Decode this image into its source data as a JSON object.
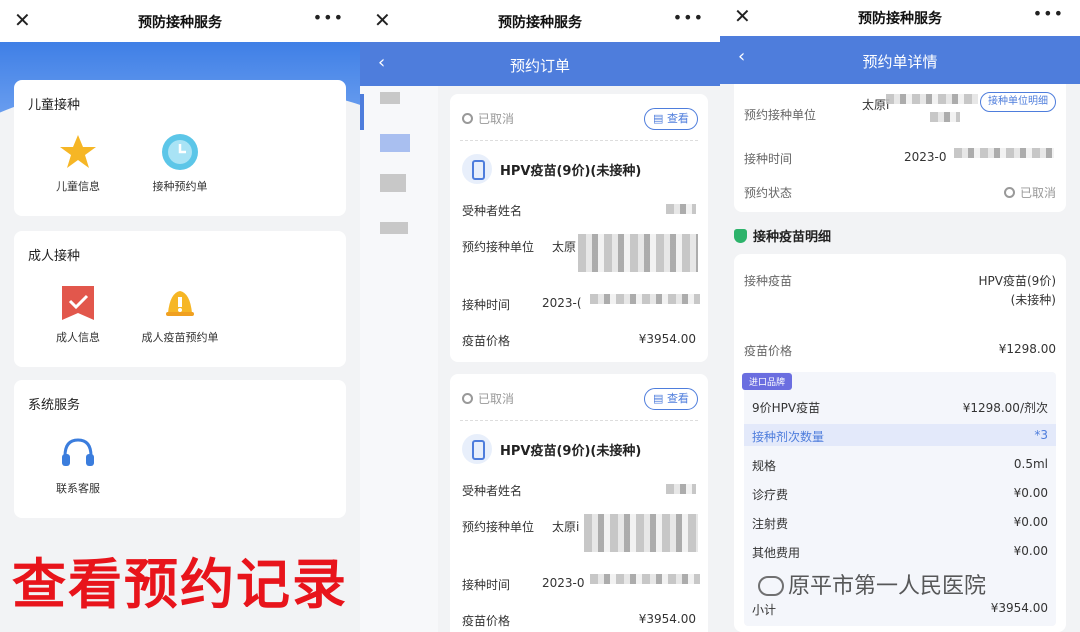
{
  "panel1": {
    "title": "预防接种服务",
    "close_icon": "close-icon",
    "more": "•••",
    "child_section": {
      "title": "儿童接种",
      "items": [
        {
          "label": "儿童信息",
          "icon": "star-icon",
          "color": "#f6b625"
        },
        {
          "label": "接种预约单",
          "icon": "clock-icon",
          "color": "#5cc6e8"
        }
      ]
    },
    "adult_section": {
      "title": "成人接种",
      "items": [
        {
          "label": "成人信息",
          "icon": "check-badge-icon",
          "color": "#e2574c"
        },
        {
          "label": "成人疫苗预约单",
          "icon": "bell-icon",
          "color": "#f6b625"
        }
      ]
    },
    "system_section": {
      "title": "系统服务",
      "items": [
        {
          "label": "联系客服",
          "icon": "headset-icon",
          "color": "#3b7ddd"
        }
      ]
    },
    "overlay_text": "查看预约记录"
  },
  "panel2": {
    "titlebar": "预防接种服务",
    "header": "预约订单",
    "orders": [
      {
        "status": "已取消",
        "view": "查看",
        "vaccine": "HPV疫苗(9价)(未接种)",
        "recipient_label": "受种者姓名",
        "unit_label": "预约接种单位",
        "unit_value": "太原",
        "time_label": "接种时间",
        "time_value": "2023-(",
        "price_label": "疫苗价格",
        "price_value": "¥3954.00"
      },
      {
        "status": "已取消",
        "view": "查看",
        "vaccine": "HPV疫苗(9价)(未接种)",
        "recipient_label": "受种者姓名",
        "unit_label": "预约接种单位",
        "unit_value": "太原i",
        "time_label": "接种时间",
        "time_value": "2023-0",
        "price_label": "疫苗价格",
        "price_value": "¥3954.00"
      }
    ]
  },
  "panel3": {
    "titlebar": "预防接种服务",
    "header": "预约单详情",
    "unit_label": "预约接种单位",
    "unit_value": "太原ī",
    "unit_btn": "接种单位明细",
    "time_label": "接种时间",
    "time_value": "2023-0",
    "state_label": "预约状态",
    "state_value": "已取消",
    "section_title": "接种疫苗明细",
    "vaccine_label": "接种疫苗",
    "vaccine_value_line1": "HPV疫苗(9价)",
    "vaccine_value_line2": "(未接种)",
    "price_label": "疫苗价格",
    "price_value": "¥1298.00",
    "badge": "进口品牌",
    "rows": [
      {
        "label": "9价HPV疫苗",
        "value": "¥1298.00/剂次"
      },
      {
        "label": "接种剂次数量",
        "value": "*3"
      },
      {
        "label": "规格",
        "value": "0.5ml"
      },
      {
        "label": "诊疗费",
        "value": "¥0.00"
      },
      {
        "label": "注射费",
        "value": "¥0.00"
      },
      {
        "label": "其他费用",
        "value": "¥0.00"
      },
      {
        "label": "小计",
        "value": "¥3954.00"
      }
    ],
    "watermark": "原平市第一人民医院"
  }
}
